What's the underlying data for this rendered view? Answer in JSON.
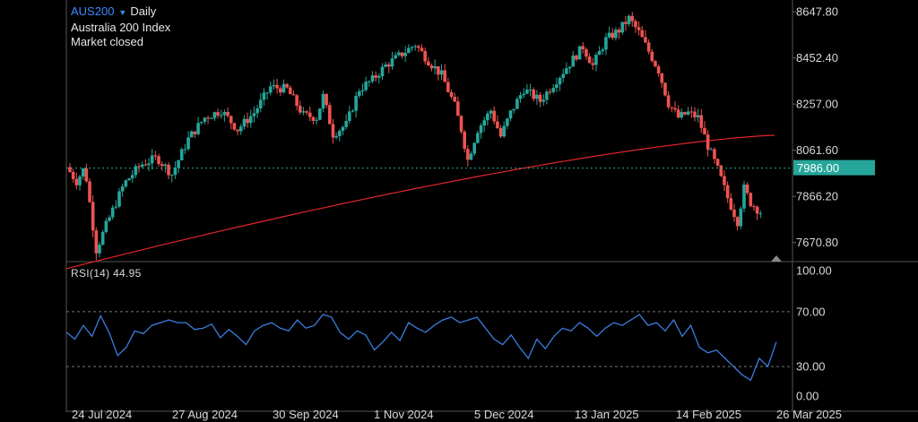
{
  "header": {
    "symbol": "AUS200",
    "interval": "Daily",
    "name": "Australia 200 Index",
    "status": "Market closed"
  },
  "current_price_label": "7986.00",
  "rsi_label": "RSI(14) 44.95",
  "colors": {
    "up": "#26a69a",
    "down": "#ef5350",
    "ma": "#e0262b",
    "rsi": "#3b7ddd",
    "price_line": "#26a69a",
    "grid": "#3a3a3a",
    "text": "#d8d8d8",
    "symbol": "#3d8bff"
  },
  "chart_data": [
    {
      "type": "candlestick",
      "title": "AUS200 Daily",
      "x_ticks": [
        "24 Jul 2024",
        "27 Aug 2024",
        "30 Sep 2024",
        "1 Nov 2024",
        "5 Dec 2024",
        "13 Jan 2025",
        "14 Feb 2025",
        "26 Mar 2025"
      ],
      "y_ticks": [
        "8647.80",
        "8452.40",
        "8257.00",
        "8061.60",
        "7866.20",
        "7670.80"
      ],
      "ylim": [
        7590,
        8690
      ],
      "last_price": 7986.0,
      "moving_average_label": "",
      "moving_average_endpoints": [
        7560,
        8125
      ],
      "close_path": [
        [
          0,
          7990
        ],
        [
          6,
          7930
        ],
        [
          11,
          7990
        ],
        [
          18,
          7640
        ],
        [
          25,
          7760
        ],
        [
          35,
          7920
        ],
        [
          45,
          8000
        ],
        [
          55,
          8030
        ],
        [
          64,
          7960
        ],
        [
          74,
          8110
        ],
        [
          84,
          8200
        ],
        [
          94,
          8230
        ],
        [
          104,
          8150
        ],
        [
          114,
          8220
        ],
        [
          124,
          8330
        ],
        [
          134,
          8320
        ],
        [
          144,
          8210
        ],
        [
          152,
          8200
        ],
        [
          156,
          8290
        ],
        [
          162,
          8130
        ],
        [
          170,
          8170
        ],
        [
          178,
          8320
        ],
        [
          186,
          8360
        ],
        [
          194,
          8420
        ],
        [
          204,
          8470
        ],
        [
          212,
          8510
        ],
        [
          220,
          8440
        ],
        [
          228,
          8380
        ],
        [
          236,
          8250
        ],
        [
          240,
          8150
        ],
        [
          244,
          8020
        ],
        [
          250,
          8150
        ],
        [
          258,
          8230
        ],
        [
          264,
          8120
        ],
        [
          270,
          8220
        ],
        [
          278,
          8320
        ],
        [
          288,
          8270
        ],
        [
          298,
          8360
        ],
        [
          306,
          8430
        ],
        [
          314,
          8500
        ],
        [
          320,
          8420
        ],
        [
          328,
          8530
        ],
        [
          336,
          8570
        ],
        [
          342,
          8620
        ],
        [
          348,
          8560
        ],
        [
          354,
          8480
        ],
        [
          360,
          8400
        ],
        [
          366,
          8260
        ],
        [
          372,
          8200
        ],
        [
          378,
          8220
        ],
        [
          384,
          8200
        ],
        [
          390,
          8080
        ],
        [
          396,
          7980
        ],
        [
          402,
          7860
        ],
        [
          408,
          7760
        ],
        [
          412,
          7900
        ],
        [
          416,
          7840
        ],
        [
          422,
          7800
        ]
      ]
    },
    {
      "type": "line",
      "title": "RSI(14)",
      "indicator": "RSI(14)",
      "last_value": 44.95,
      "y_ticks": [
        "100.00",
        "70.00",
        "30.00",
        "0.00"
      ],
      "ylim": [
        0,
        100
      ],
      "reference_lines": [
        70,
        30
      ],
      "series": [
        {
          "values": [
            55,
            50,
            60,
            52,
            67,
            55,
            38,
            44,
            56,
            54,
            60,
            62,
            64,
            62,
            62,
            57,
            58,
            61,
            51,
            57,
            52,
            46,
            56,
            60,
            62,
            58,
            56,
            64,
            58,
            60,
            68,
            66,
            55,
            50,
            56,
            53,
            42,
            48,
            55,
            49,
            62,
            58,
            55,
            60,
            64,
            66,
            62,
            64,
            66,
            58,
            50,
            46,
            53,
            44,
            36,
            50,
            43,
            52,
            58,
            56,
            62,
            58,
            52,
            58,
            62,
            60,
            64,
            68,
            60,
            62,
            56,
            64,
            52,
            60,
            44,
            40,
            42,
            36,
            30,
            24,
            20,
            36,
            30,
            48
          ]
        }
      ]
    }
  ]
}
